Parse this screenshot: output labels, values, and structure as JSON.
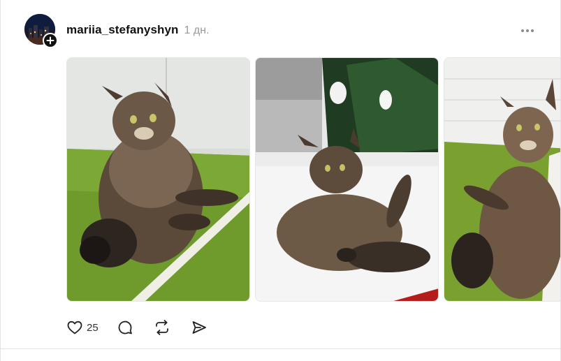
{
  "post": {
    "username": "mariia_stefanyshyn",
    "timestamp": "1 дн.",
    "photos": [
      {
        "description_icon": "cat-photo"
      },
      {
        "description_icon": "cat-photo"
      },
      {
        "description_icon": "cat-photo"
      }
    ],
    "actions": {
      "like_count": "25"
    }
  },
  "icons": {
    "like": "heart-icon",
    "comment": "comment-icon",
    "repost": "repost-icon",
    "share": "send-icon",
    "more": "more-dots-icon",
    "follow": "plus-icon"
  }
}
